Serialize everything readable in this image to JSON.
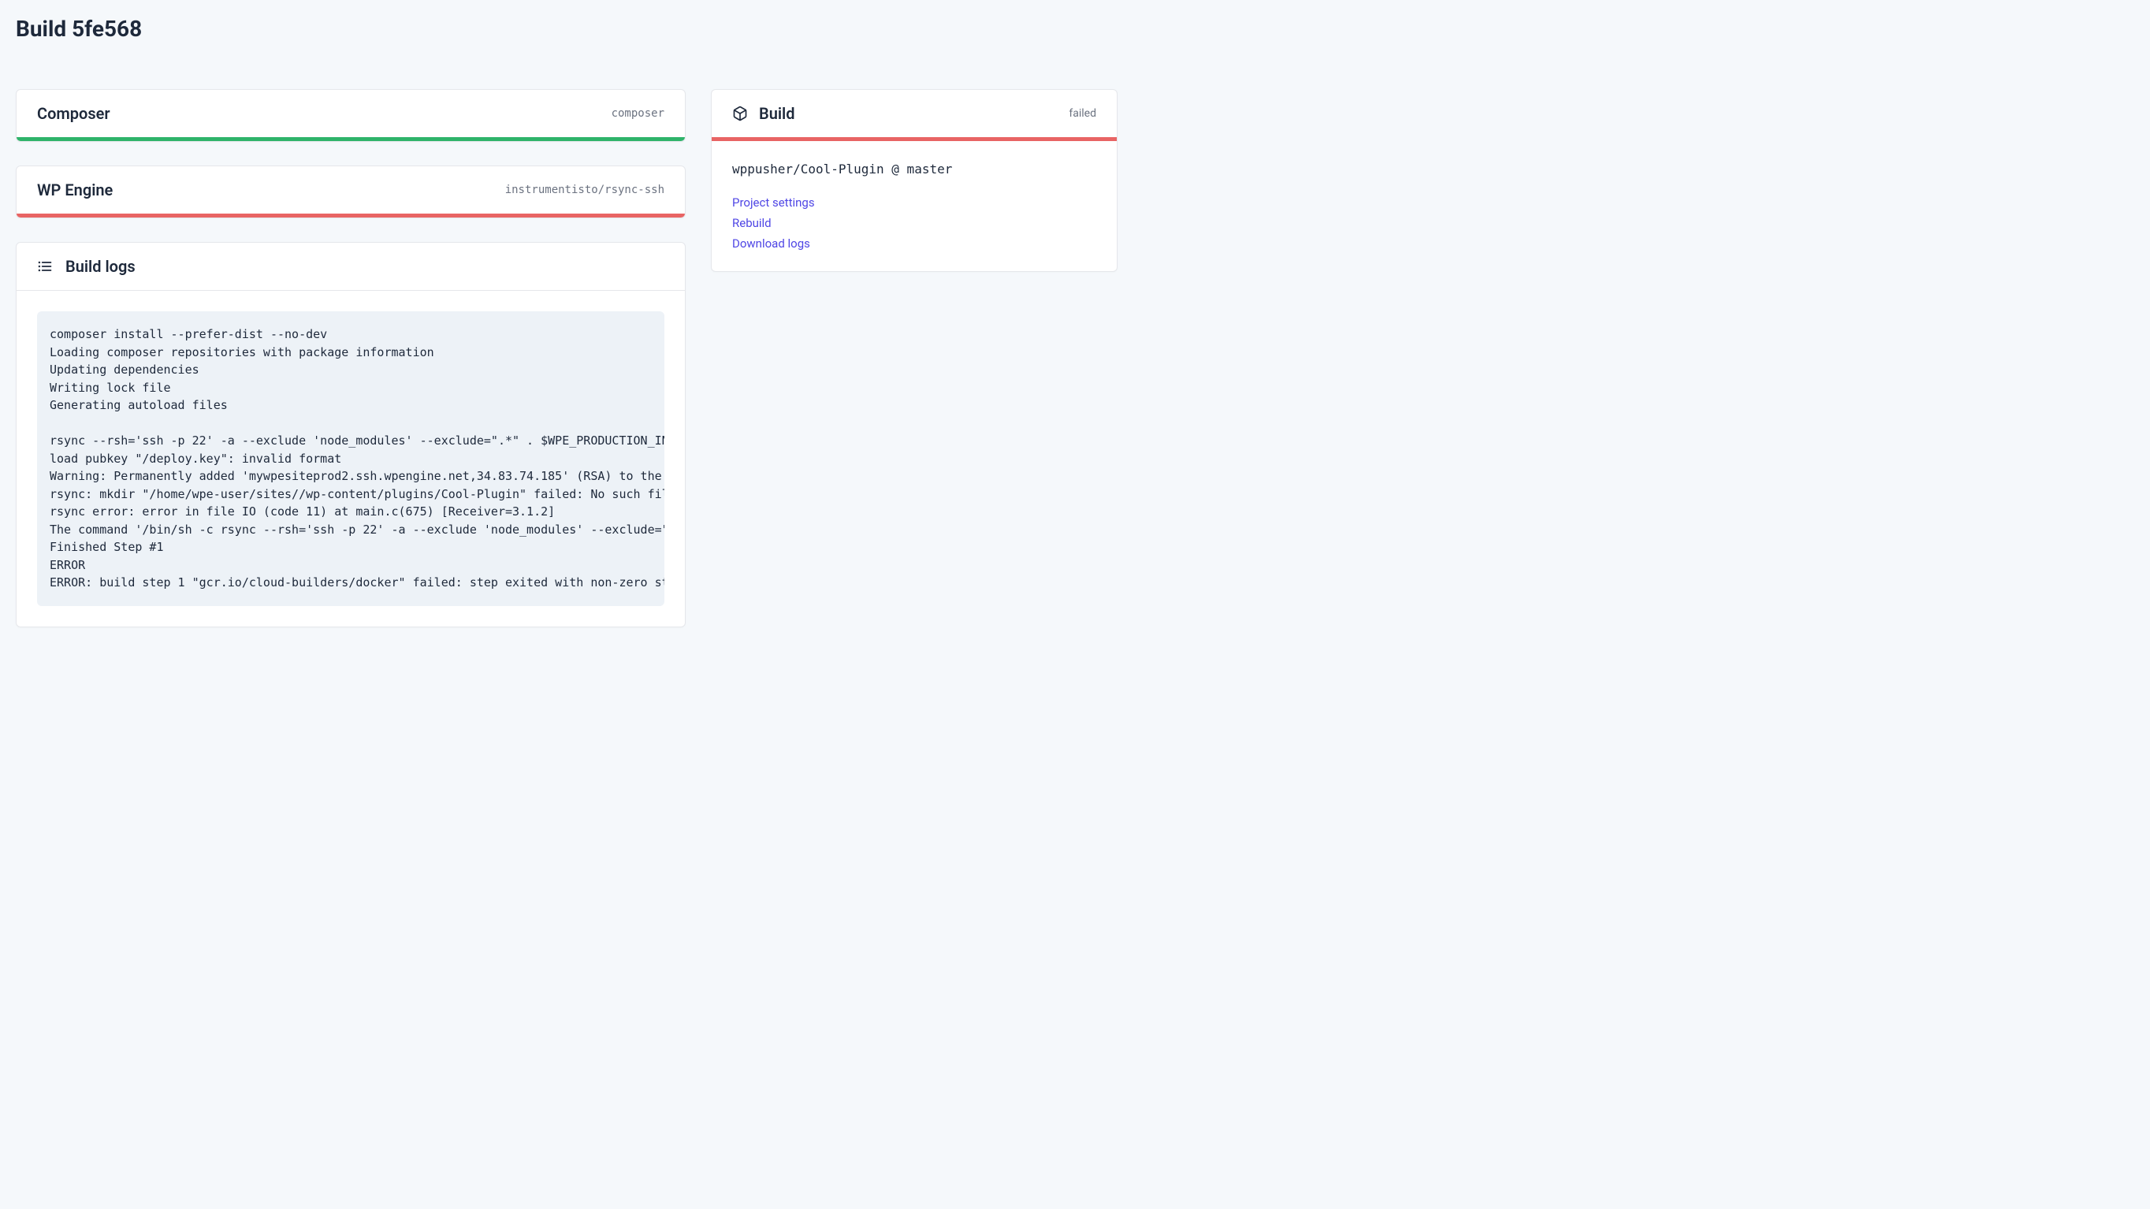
{
  "page": {
    "title": "Build 5fe568"
  },
  "steps": [
    {
      "title": "Composer",
      "meta": "composer",
      "status": "success"
    },
    {
      "title": "WP Engine",
      "meta": "instrumentisto/rsync-ssh",
      "status": "failed"
    }
  ],
  "logs": {
    "title": "Build logs",
    "content": "composer install --prefer-dist --no-dev\nLoading composer repositories with package information\nUpdating dependencies\nWriting lock file\nGenerating autoload files\n\nrsync --rsh='ssh -p 22' -a --exclude 'node_modules' --exclude=\".*\" . $WPE_PRODUCTION_IN\nload pubkey \"/deploy.key\": invalid format\nWarning: Permanently added 'mywpesiteprod2.ssh.wpengine.net,34.83.74.185' (RSA) to the \nrsync: mkdir \"/home/wpe-user/sites//wp-content/plugins/Cool-Plugin\" failed: No such fil\nrsync error: error in file IO (code 11) at main.c(675) [Receiver=3.1.2]\nThe command '/bin/sh -c rsync --rsh='ssh -p 22' -a --exclude 'node_modules' --exclude=\"\nFinished Step #1\nERROR\nERROR: build step 1 \"gcr.io/cloud-builders/docker\" failed: step exited with non-zero st"
  },
  "build": {
    "title": "Build",
    "status": "failed",
    "repo": "wppusher/Cool-Plugin @ master",
    "links": {
      "project_settings": "Project settings",
      "rebuild": "Rebuild",
      "download_logs": "Download logs"
    }
  }
}
